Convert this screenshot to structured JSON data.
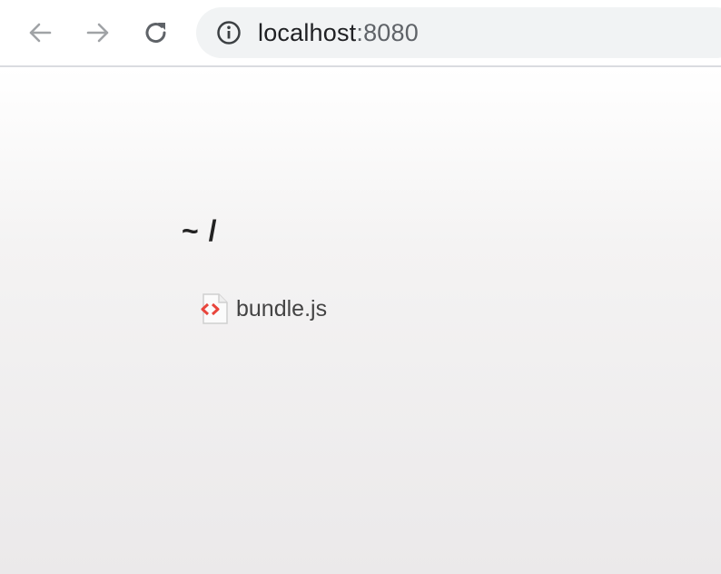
{
  "browser": {
    "url_host": "localhost",
    "url_port": ":8080",
    "nav": {
      "back_icon": "arrow-left-icon",
      "forward_icon": "arrow-right-icon",
      "reload_icon": "reload-icon",
      "site_info_icon": "info-icon"
    }
  },
  "page": {
    "heading": "~ /",
    "files": [
      {
        "name": "bundle.js",
        "icon": "code-file-icon"
      }
    ]
  },
  "colors": {
    "file_icon_accent": "#e8453c",
    "disabled_nav": "#a0a3a6",
    "active_nav": "#5f6368"
  }
}
